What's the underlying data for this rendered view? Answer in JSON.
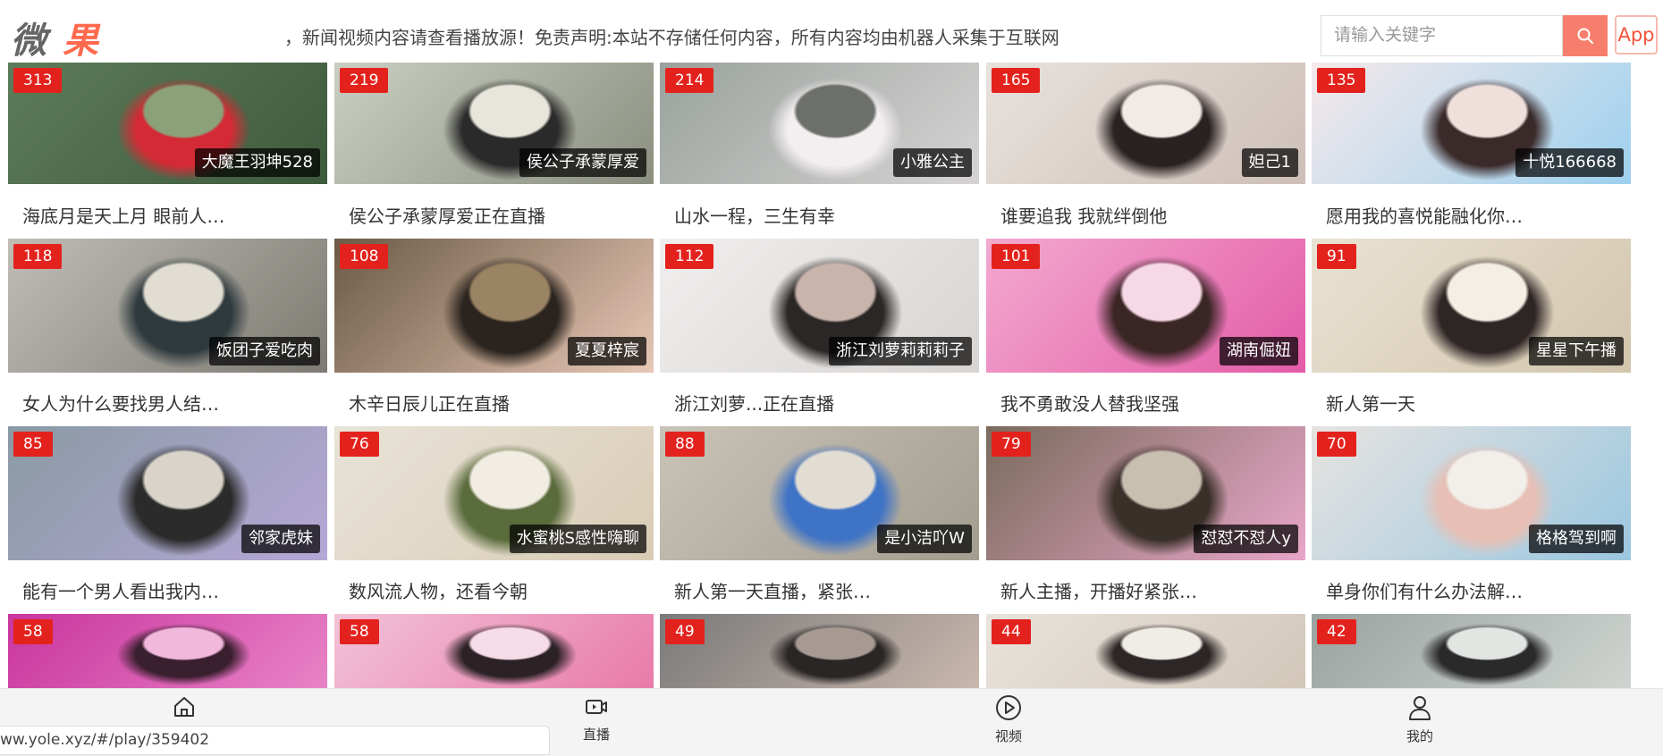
{
  "header": {
    "logo_char1": "微",
    "logo_char2": "果",
    "notice": "，新闻视频内容请查看播放源！免责声明:本站不存储任何内容，所有内容均由机器人采集于互联网",
    "search_placeholder": "请输入关键字",
    "app_label": "App"
  },
  "cards": [
    {
      "viewers": "313",
      "anchor": "大魔王羽坤528",
      "title": "海底月是天上月 眼前人…",
      "palette": [
        "#5d7c5a",
        "#3e5a3c",
        "#d42a35",
        "#8aa17a"
      ]
    },
    {
      "viewers": "219",
      "anchor": "侯公子承蒙厚爱",
      "title": "侯公子承蒙厚爱正在直播",
      "palette": [
        "#c9cfc2",
        "#8b8f80",
        "#2a2a2a",
        "#e8e6dc"
      ]
    },
    {
      "viewers": "214",
      "anchor": "小雅公主",
      "title": "山水一程，三生有幸",
      "palette": [
        "#9aa29c",
        "#d6d3d4",
        "#f3eef0",
        "#6c6f6a"
      ]
    },
    {
      "viewers": "165",
      "anchor": "妲己1",
      "title": "谁要追我 我就绊倒他",
      "palette": [
        "#e8e2dc",
        "#cdbfb8",
        "#2a2222",
        "#f1ebe5"
      ]
    },
    {
      "viewers": "135",
      "anchor": "十悦166668",
      "title": "愿用我的喜悦能融化你…",
      "palette": [
        "#f5e9ea",
        "#9dd0ee",
        "#3a2a2a",
        "#efe0dc"
      ]
    },
    {
      "viewers": "118",
      "anchor": "饭团子爱吃肉",
      "title": "女人为什么要找男人结…",
      "palette": [
        "#bfbdb5",
        "#7d7a72",
        "#2f3a3e",
        "#e1ddd2"
      ]
    },
    {
      "viewers": "108",
      "anchor": "夏夏梓宸",
      "title": "木辛日辰儿正在直播",
      "palette": [
        "#6b5a44",
        "#e7c7b5",
        "#2a231e",
        "#9b8464"
      ]
    },
    {
      "viewers": "112",
      "anchor": "浙江刘萝莉莉莉子",
      "title": "浙江刘萝...正在直播",
      "palette": [
        "#f0efee",
        "#d8d4d2",
        "#2a2726",
        "#c9b4ac"
      ]
    },
    {
      "viewers": "101",
      "anchor": "湖南倔妞",
      "title": "我不勇敢没人替我坚强",
      "palette": [
        "#f3a9cf",
        "#e35ba8",
        "#3b2626",
        "#f7d8e6"
      ]
    },
    {
      "viewers": "91",
      "anchor": "星星下午播",
      "title": "新人第一天",
      "palette": [
        "#e9e2d3",
        "#d2c5ac",
        "#2e2525",
        "#f4efe4"
      ]
    },
    {
      "viewers": "85",
      "anchor": "邻家虎妹",
      "title": "能有一个男人看出我内…",
      "palette": [
        "#8a9aa4",
        "#b5a7d6",
        "#2b2b2b",
        "#d9d3c9"
      ]
    },
    {
      "viewers": "76",
      "anchor": "水蜜桃S感性嗨聊",
      "title": "数风流人物，还看今朝",
      "palette": [
        "#e8e3d8",
        "#d9ccb5",
        "#5a6b3c",
        "#f2ede3"
      ]
    },
    {
      "viewers": "88",
      "anchor": "是小洁吖W",
      "title": "新人第一天直播，紧张…",
      "palette": [
        "#c9c3b8",
        "#a39d90",
        "#3f73c5",
        "#e2ddd3"
      ]
    },
    {
      "viewers": "79",
      "anchor": "怼怼不怼人y",
      "title": "新人主播，开播好紧张…",
      "palette": [
        "#7a6b5c",
        "#e8a6c9",
        "#3a302a",
        "#c9bfb1"
      ]
    },
    {
      "viewers": "70",
      "anchor": "格格驾到啊",
      "title": "单身你们有什么办法解…",
      "palette": [
        "#e7e3e0",
        "#9bc7e0",
        "#e7bfb4",
        "#f2eeea"
      ]
    },
    {
      "viewers": "58",
      "anchor": "",
      "title": "",
      "palette": [
        "#c9359e",
        "#e883c6",
        "#3a1f2e",
        "#f2b8dc"
      ]
    },
    {
      "viewers": "58",
      "anchor": "",
      "title": "",
      "palette": [
        "#f2c3d8",
        "#e87aa8",
        "#2c2226",
        "#f6dbe8"
      ]
    },
    {
      "viewers": "49",
      "anchor": "",
      "title": "",
      "palette": [
        "#7a7a7a",
        "#c9b7ad",
        "#2a2626",
        "#a69a92"
      ]
    },
    {
      "viewers": "44",
      "anchor": "",
      "title": "",
      "palette": [
        "#e8e3dc",
        "#d2c7b9",
        "#2c2626",
        "#f0ece6"
      ]
    },
    {
      "viewers": "42",
      "anchor": "",
      "title": "",
      "palette": [
        "#9aa3a0",
        "#cfd4d0",
        "#2a2a2a",
        "#e1e6e2"
      ]
    }
  ],
  "bottom_nav": [
    {
      "label": "",
      "icon": "home-icon"
    },
    {
      "label": "直播",
      "icon": "live-camera-icon"
    },
    {
      "label": "视频",
      "icon": "play-circle-icon"
    },
    {
      "label": "我的",
      "icon": "user-icon"
    }
  ],
  "status_url": "ww.yole.xyz/#/play/359402"
}
